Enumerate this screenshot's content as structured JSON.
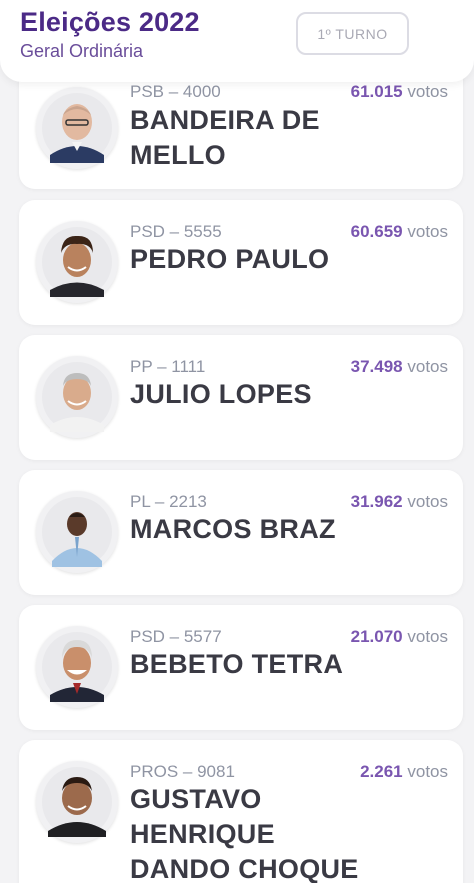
{
  "header": {
    "title": "Eleições 2022",
    "subtitle": "Geral Ordinária",
    "turno_label": "1º TURNO"
  },
  "candidates": [
    {
      "party": "PSB – 4000",
      "name": "BANDEIRA DE MELLO",
      "votes": "61.015",
      "votes_unit": "votos"
    },
    {
      "party": "PSD – 5555",
      "name": "PEDRO PAULO",
      "votes": "60.659",
      "votes_unit": "votos"
    },
    {
      "party": "PP – 1111",
      "name": "JULIO LOPES",
      "votes": "37.498",
      "votes_unit": "votos"
    },
    {
      "party": "PL – 2213",
      "name": "MARCOS BRAZ",
      "votes": "31.962",
      "votes_unit": "votos"
    },
    {
      "party": "PSD – 5577",
      "name": "BEBETO TETRA",
      "votes": "21.070",
      "votes_unit": "votos"
    },
    {
      "party": "PROS – 9081",
      "name": "GUSTAVO HENRIQUE DANDO CHOQUE",
      "votes": "2.261",
      "votes_unit": "votos"
    }
  ],
  "colors": {
    "brand": "#4b2a86",
    "votes_accent": "#7a56b0",
    "background": "#f3f3f5"
  }
}
